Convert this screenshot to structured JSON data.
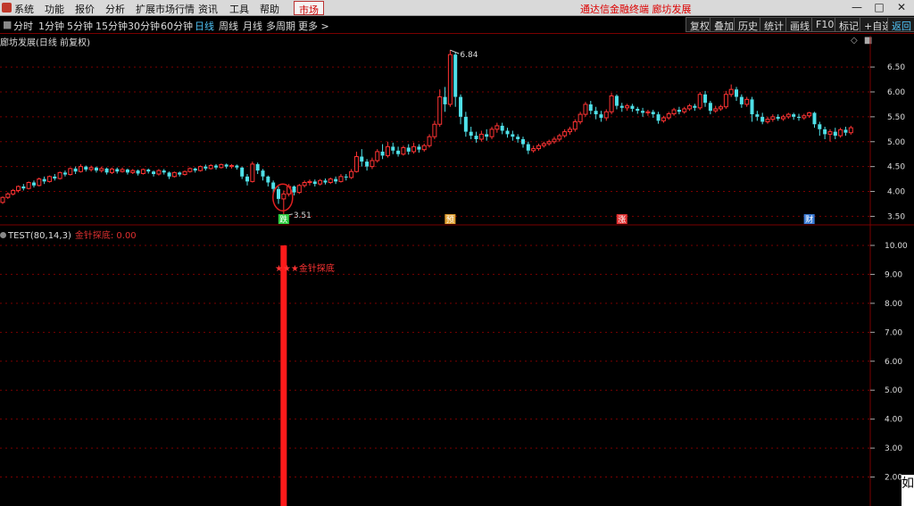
{
  "menu": {
    "items": [
      "系统",
      "功能",
      "报价",
      "分析",
      "扩展市场行情",
      "资讯",
      "工具",
      "帮助"
    ],
    "market_tab": "市场",
    "brand_title": "通达信金融终端  廊坊发展"
  },
  "periods": {
    "items": [
      "分时",
      "1分钟",
      "5分钟",
      "15分钟",
      "30分钟",
      "60分钟",
      "日线",
      "周线",
      "月线",
      "多周期",
      "更多 >"
    ],
    "active": "日线"
  },
  "tools": [
    "复权",
    "叠加",
    "历史",
    "统计",
    "画线",
    "F10",
    "标记",
    "+自选",
    "返回"
  ],
  "main_chart": {
    "title": "廊坊发展(日线 前复权)",
    "y_ticks": [
      "6.50",
      "6.00",
      "5.50",
      "5.00",
      "4.50",
      "4.00",
      "3.50"
    ],
    "high_label": "6.84",
    "low_label": "3.51",
    "event_markers": [
      "跌",
      "预",
      "涨",
      "财"
    ]
  },
  "indicator": {
    "name": "TEST(80,14,3)",
    "value_label": "金针探底: 0.00",
    "y_ticks": [
      "10.00",
      "9.00",
      "8.00",
      "7.00",
      "6.00",
      "5.00",
      "4.00",
      "3.00",
      "2.00"
    ],
    "signal_label": "★★★金针探底"
  },
  "watermark": "如",
  "colors": {
    "up": "#ff3333",
    "down": "#4fe0e8",
    "grid": "#7a0000",
    "active_period": "#4fc3f7"
  },
  "chart_data": {
    "type": "candlestick",
    "ylim": [
      3.4,
      6.95
    ],
    "candles": [
      [
        3.78,
        3.88,
        3.75,
        3.9
      ],
      [
        3.88,
        3.95,
        3.85,
        3.98
      ],
      [
        3.95,
        4.02,
        3.92,
        4.05
      ],
      [
        4.02,
        4.1,
        3.98,
        4.12
      ],
      [
        4.1,
        4.06,
        4.02,
        4.15
      ],
      [
        4.06,
        4.18,
        4.04,
        4.2
      ],
      [
        4.18,
        4.12,
        4.08,
        4.22
      ],
      [
        4.12,
        4.25,
        4.1,
        4.28
      ],
      [
        4.25,
        4.2,
        4.15,
        4.3
      ],
      [
        4.2,
        4.3,
        4.18,
        4.32
      ],
      [
        4.3,
        4.26,
        4.22,
        4.35
      ],
      [
        4.26,
        4.38,
        4.24,
        4.4
      ],
      [
        4.38,
        4.34,
        4.3,
        4.42
      ],
      [
        4.34,
        4.46,
        4.32,
        4.48
      ],
      [
        4.46,
        4.4,
        4.35,
        4.5
      ],
      [
        4.4,
        4.5,
        4.38,
        4.55
      ],
      [
        4.5,
        4.44,
        4.4,
        4.52
      ],
      [
        4.44,
        4.48,
        4.4,
        4.52
      ],
      [
        4.48,
        4.42,
        4.38,
        4.5
      ],
      [
        4.42,
        4.46,
        4.38,
        4.5
      ],
      [
        4.46,
        4.38,
        4.34,
        4.48
      ],
      [
        4.38,
        4.45,
        4.35,
        4.48
      ],
      [
        4.45,
        4.4,
        4.36,
        4.48
      ],
      [
        4.4,
        4.44,
        4.38,
        4.48
      ],
      [
        4.44,
        4.38,
        4.34,
        4.46
      ],
      [
        4.38,
        4.42,
        4.35,
        4.45
      ],
      [
        4.42,
        4.36,
        4.32,
        4.44
      ],
      [
        4.36,
        4.44,
        4.34,
        4.46
      ],
      [
        4.44,
        4.4,
        4.36,
        4.46
      ],
      [
        4.4,
        4.35,
        4.3,
        4.42
      ],
      [
        4.35,
        4.42,
        4.32,
        4.45
      ],
      [
        4.42,
        4.38,
        4.34,
        4.45
      ],
      [
        4.38,
        4.3,
        4.25,
        4.4
      ],
      [
        4.3,
        4.38,
        4.28,
        4.4
      ],
      [
        4.38,
        4.34,
        4.3,
        4.4
      ],
      [
        4.34,
        4.4,
        4.32,
        4.42
      ],
      [
        4.4,
        4.46,
        4.38,
        4.48
      ],
      [
        4.46,
        4.42,
        4.38,
        4.48
      ],
      [
        4.42,
        4.5,
        4.4,
        4.52
      ],
      [
        4.5,
        4.46,
        4.42,
        4.54
      ],
      [
        4.46,
        4.52,
        4.44,
        4.55
      ],
      [
        4.52,
        4.48,
        4.44,
        4.55
      ],
      [
        4.48,
        4.54,
        4.46,
        4.56
      ],
      [
        4.54,
        4.5,
        4.46,
        4.56
      ],
      [
        4.5,
        4.52,
        4.46,
        4.55
      ],
      [
        4.52,
        4.48,
        4.44,
        4.54
      ],
      [
        4.48,
        4.3,
        4.25,
        4.5
      ],
      [
        4.3,
        4.2,
        4.12,
        4.35
      ],
      [
        4.2,
        4.55,
        4.18,
        4.6
      ],
      [
        4.55,
        4.42,
        4.35,
        4.58
      ],
      [
        4.42,
        4.3,
        4.22,
        4.45
      ],
      [
        4.3,
        4.18,
        4.1,
        4.32
      ],
      [
        4.18,
        4.05,
        3.95,
        4.22
      ],
      [
        4.05,
        3.85,
        3.75,
        4.1
      ],
      [
        3.85,
        3.95,
        3.51,
        4.02
      ],
      [
        3.95,
        4.1,
        3.9,
        4.15
      ],
      [
        4.1,
        3.98,
        3.92,
        4.12
      ],
      [
        3.98,
        4.12,
        3.95,
        4.15
      ],
      [
        4.12,
        4.18,
        4.08,
        4.22
      ],
      [
        4.18,
        4.2,
        4.12,
        4.24
      ],
      [
        4.2,
        4.15,
        4.1,
        4.24
      ],
      [
        4.15,
        4.22,
        4.12,
        4.25
      ],
      [
        4.22,
        4.18,
        4.14,
        4.26
      ],
      [
        4.18,
        4.25,
        4.15,
        4.28
      ],
      [
        4.25,
        4.2,
        4.15,
        4.3
      ],
      [
        4.2,
        4.3,
        4.18,
        4.35
      ],
      [
        4.3,
        4.28,
        4.22,
        4.35
      ],
      [
        4.28,
        4.4,
        4.25,
        4.45
      ],
      [
        4.4,
        4.7,
        4.38,
        4.8
      ],
      [
        4.7,
        4.6,
        4.5,
        4.85
      ],
      [
        4.6,
        4.5,
        4.42,
        4.65
      ],
      [
        4.5,
        4.62,
        4.45,
        4.68
      ],
      [
        4.62,
        4.8,
        4.58,
        4.85
      ],
      [
        4.8,
        4.72,
        4.65,
        4.95
      ],
      [
        4.72,
        4.9,
        4.68,
        5.0
      ],
      [
        4.9,
        4.82,
        4.75,
        4.98
      ],
      [
        4.82,
        4.75,
        4.7,
        4.9
      ],
      [
        4.75,
        4.88,
        4.72,
        4.92
      ],
      [
        4.88,
        4.8,
        4.74,
        4.95
      ],
      [
        4.8,
        4.9,
        4.76,
        4.98
      ],
      [
        4.9,
        4.84,
        4.78,
        4.95
      ],
      [
        4.84,
        4.92,
        4.8,
        4.96
      ],
      [
        4.92,
        5.1,
        4.88,
        5.15
      ],
      [
        5.1,
        5.35,
        5.05,
        5.42
      ],
      [
        5.35,
        5.9,
        5.3,
        6.05
      ],
      [
        5.9,
        5.75,
        5.6,
        6.1
      ],
      [
        5.75,
        6.75,
        5.7,
        6.84
      ],
      [
        6.75,
        5.9,
        5.7,
        6.8
      ],
      [
        5.9,
        5.5,
        5.35,
        5.95
      ],
      [
        5.5,
        5.2,
        5.1,
        5.6
      ],
      [
        5.2,
        5.12,
        5.05,
        5.3
      ],
      [
        5.12,
        5.05,
        4.98,
        5.2
      ],
      [
        5.05,
        5.15,
        5.0,
        5.22
      ],
      [
        5.15,
        5.1,
        5.02,
        5.25
      ],
      [
        5.1,
        5.25,
        5.05,
        5.3
      ],
      [
        5.25,
        5.32,
        5.18,
        5.38
      ],
      [
        5.32,
        5.22,
        5.15,
        5.38
      ],
      [
        5.22,
        5.15,
        5.08,
        5.28
      ],
      [
        5.15,
        5.1,
        5.02,
        5.22
      ],
      [
        5.1,
        5.05,
        4.98,
        5.15
      ],
      [
        5.05,
        4.95,
        4.88,
        5.1
      ],
      [
        4.95,
        4.82,
        4.75,
        5.0
      ],
      [
        4.82,
        4.86,
        4.78,
        4.92
      ],
      [
        4.86,
        4.92,
        4.82,
        4.96
      ],
      [
        4.92,
        4.96,
        4.88,
        5.0
      ],
      [
        4.96,
        5.0,
        4.92,
        5.04
      ],
      [
        5.0,
        5.05,
        4.96,
        5.1
      ],
      [
        5.05,
        5.12,
        5.0,
        5.16
      ],
      [
        5.12,
        5.2,
        5.08,
        5.25
      ],
      [
        5.2,
        5.25,
        5.14,
        5.3
      ],
      [
        5.25,
        5.4,
        5.2,
        5.45
      ],
      [
        5.4,
        5.55,
        5.35,
        5.6
      ],
      [
        5.55,
        5.75,
        5.5,
        5.8
      ],
      [
        5.75,
        5.62,
        5.55,
        5.82
      ],
      [
        5.62,
        5.55,
        5.45,
        5.7
      ],
      [
        5.55,
        5.48,
        5.4,
        5.62
      ],
      [
        5.48,
        5.6,
        5.42,
        5.65
      ],
      [
        5.6,
        5.92,
        5.55,
        5.98
      ],
      [
        5.92,
        5.72,
        5.65,
        5.95
      ],
      [
        5.72,
        5.68,
        5.6,
        5.78
      ],
      [
        5.68,
        5.72,
        5.62,
        5.76
      ],
      [
        5.72,
        5.66,
        5.6,
        5.76
      ],
      [
        5.66,
        5.62,
        5.56,
        5.7
      ],
      [
        5.62,
        5.58,
        5.5,
        5.68
      ],
      [
        5.58,
        5.6,
        5.52,
        5.64
      ],
      [
        5.6,
        5.55,
        5.48,
        5.64
      ],
      [
        5.55,
        5.42,
        5.36,
        5.6
      ],
      [
        5.42,
        5.48,
        5.38,
        5.52
      ],
      [
        5.48,
        5.56,
        5.44,
        5.6
      ],
      [
        5.56,
        5.64,
        5.52,
        5.68
      ],
      [
        5.64,
        5.6,
        5.55,
        5.7
      ],
      [
        5.6,
        5.66,
        5.56,
        5.7
      ],
      [
        5.66,
        5.72,
        5.62,
        5.76
      ],
      [
        5.72,
        5.68,
        5.62,
        5.76
      ],
      [
        5.68,
        5.95,
        5.64,
        6.0
      ],
      [
        5.95,
        5.78,
        5.7,
        6.02
      ],
      [
        5.78,
        5.62,
        5.55,
        5.82
      ],
      [
        5.62,
        5.66,
        5.58,
        5.72
      ],
      [
        5.66,
        5.7,
        5.62,
        5.74
      ],
      [
        5.7,
        5.95,
        5.66,
        6.02
      ],
      [
        5.95,
        6.05,
        5.9,
        6.15
      ],
      [
        6.05,
        5.9,
        5.82,
        6.1
      ],
      [
        5.9,
        5.75,
        5.68,
        5.95
      ],
      [
        5.75,
        5.85,
        5.7,
        5.9
      ],
      [
        5.85,
        5.55,
        5.4,
        5.9
      ],
      [
        5.55,
        5.5,
        5.42,
        5.62
      ],
      [
        5.5,
        5.4,
        5.35,
        5.58
      ],
      [
        5.4,
        5.45,
        5.36,
        5.5
      ],
      [
        5.45,
        5.5,
        5.4,
        5.55
      ],
      [
        5.5,
        5.46,
        5.42,
        5.55
      ],
      [
        5.46,
        5.5,
        5.42,
        5.54
      ],
      [
        5.5,
        5.55,
        5.46,
        5.58
      ],
      [
        5.55,
        5.5,
        5.44,
        5.58
      ],
      [
        5.5,
        5.48,
        5.42,
        5.56
      ],
      [
        5.48,
        5.52,
        5.44,
        5.56
      ],
      [
        5.52,
        5.58,
        5.48,
        5.6
      ],
      [
        5.58,
        5.35,
        5.28,
        5.6
      ],
      [
        5.35,
        5.25,
        5.12,
        5.4
      ],
      [
        5.25,
        5.15,
        5.05,
        5.3
      ],
      [
        5.15,
        5.2,
        5.0,
        5.25
      ],
      [
        5.2,
        5.12,
        5.05,
        5.28
      ],
      [
        5.12,
        5.24,
        5.08,
        5.28
      ],
      [
        5.24,
        5.18,
        5.12,
        5.3
      ],
      [
        5.18,
        5.28,
        5.14,
        5.32
      ]
    ],
    "event_marker_indices": [
      54,
      86,
      119,
      155
    ],
    "low_index": 54,
    "high_index": 86,
    "indicator": {
      "ylim": [
        1.0,
        10.4
      ],
      "signal_index": 54,
      "signal_value": 10.0,
      "grid_values": [
        10,
        9,
        8,
        7,
        6,
        5,
        4,
        3,
        2
      ]
    }
  }
}
